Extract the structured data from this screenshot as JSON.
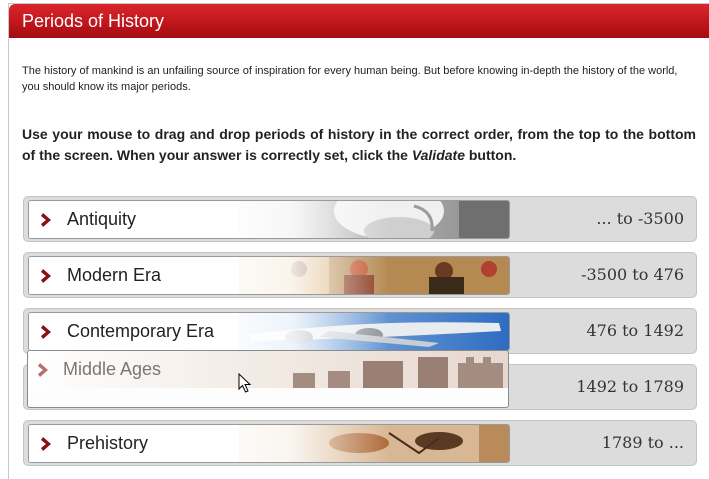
{
  "header": {
    "title": "Periods of History"
  },
  "intro": "The history of mankind is an unfailing source of inspiration for every human being. But before knowing in-depth the history of the world, you should know its major periods.",
  "instructions": {
    "before": "Use your mouse to drag and drop periods of history in the correct order, from the top to the bottom of the screen. When your answer is correctly set, click the ",
    "emphasis": "Validate",
    "after": " button."
  },
  "rows": [
    {
      "period": "Antiquity",
      "range": "... to -3500"
    },
    {
      "period": "Modern Era",
      "range": "-3500 to 476"
    },
    {
      "period": "Contemporary Era",
      "range": "476 to 1492"
    },
    {
      "period": "",
      "range": "1492 to 1789"
    },
    {
      "period": "Prehistory",
      "range": "1789 to ..."
    }
  ],
  "dragging": {
    "period": "Middle Ages"
  },
  "colors": {
    "header_red": "#c0161c",
    "chevron": "#8b1010",
    "row_bg": "#dcdcdc"
  }
}
